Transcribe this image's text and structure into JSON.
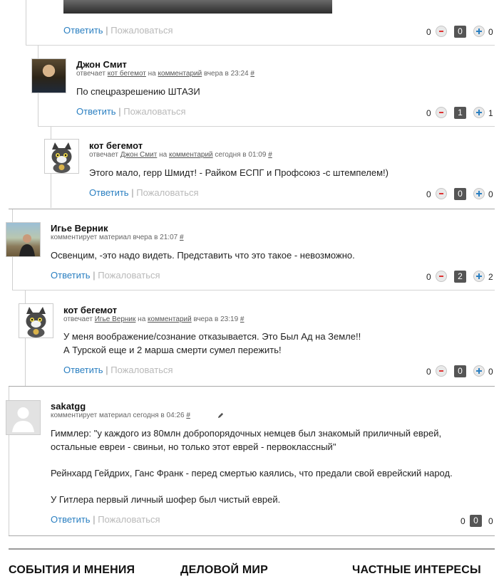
{
  "comments": [
    {
      "reply_label": "Ответить",
      "separator": "|",
      "complain_label": "Пожаловаться",
      "minus_count": "0",
      "score": "0",
      "plus_count": "0"
    },
    {
      "author": "Джон Смит",
      "meta_prefix": "отвечает",
      "target_user": "кот бегемот",
      "meta_on": "на",
      "target_link": "комментарий",
      "time": "вчера в 23:24",
      "permalink": "#",
      "text_lines": [
        "По спецразрешению ШТАЗИ"
      ],
      "reply_label": "Ответить",
      "separator": "|",
      "complain_label": "Пожаловаться",
      "minus_count": "0",
      "score": "1",
      "plus_count": "1"
    },
    {
      "author": "кот бегемот",
      "meta_prefix": "отвечает",
      "target_user": "Джон Смит",
      "meta_on": "на",
      "target_link": "комментарий",
      "time": "сегодня в 01:09",
      "permalink": "#",
      "text_lines": [
        "Этого мало, герр Шмидт! - Райком ЕСПГ и Профсоюз -с штемпелем!)"
      ],
      "reply_label": "Ответить",
      "separator": "|",
      "complain_label": "Пожаловаться",
      "minus_count": "0",
      "score": "0",
      "plus_count": "0"
    },
    {
      "author": "Игье Верник",
      "meta_prefix": "комментирует материал",
      "time": "вчера в 21:07",
      "permalink": "#",
      "text_lines": [
        "Освенцим, -это надо видеть. Представить что это такое - невозможно."
      ],
      "reply_label": "Ответить",
      "separator": "|",
      "complain_label": "Пожаловаться",
      "minus_count": "0",
      "score": "2",
      "plus_count": "2"
    },
    {
      "author": "кот бегемот",
      "meta_prefix": "отвечает",
      "target_user": "Игье Верник",
      "meta_on": "на",
      "target_link": "комментарий",
      "time": "вчера в 23:19",
      "permalink": "#",
      "text_lines": [
        "У меня воображение/сознание отказывается. Это Был Ад на Земле!!",
        "А Турской еще и 2 марша смерти сумел пережить!"
      ],
      "reply_label": "Ответить",
      "separator": "|",
      "complain_label": "Пожаловаться",
      "minus_count": "0",
      "score": "0",
      "plus_count": "0"
    },
    {
      "author": "sakatgg",
      "meta_prefix": "комментирует материал",
      "time": "сегодня в 04:26",
      "permalink": "#",
      "text_lines": [
        "Гиммлер: \"у каждого из 80млн добропорядочных немцев был знакомый приличный еврей,",
        "остальные евреи - свиньи, но только этот еврей - первоклассный\"",
        "Рейнхард Гейдрих, Ганс Франк - перед смертью каялись, что предали свой еврейский народ.",
        "У Гитлера первый личный шофер был чистый еврей."
      ],
      "reply_label": "Ответить",
      "separator": "|",
      "complain_label": "Пожаловаться",
      "minus_count": "0",
      "score": "0",
      "plus_count": "0"
    }
  ],
  "footer": {
    "sections": [
      "СОБЫТИЯ И МНЕНИЯ",
      "ДЕЛОВОЙ МИР",
      "ЧАСТНЫЕ ИНТЕРЕСЫ"
    ]
  },
  "icons": {
    "minus": "minus-circle-icon",
    "plus": "plus-circle-icon",
    "edit": "pencil-icon"
  },
  "colors": {
    "link": "#2a7fc1",
    "muted_link": "#b9b9b9",
    "score_bg": "#555555",
    "minus": "#dd3333"
  }
}
